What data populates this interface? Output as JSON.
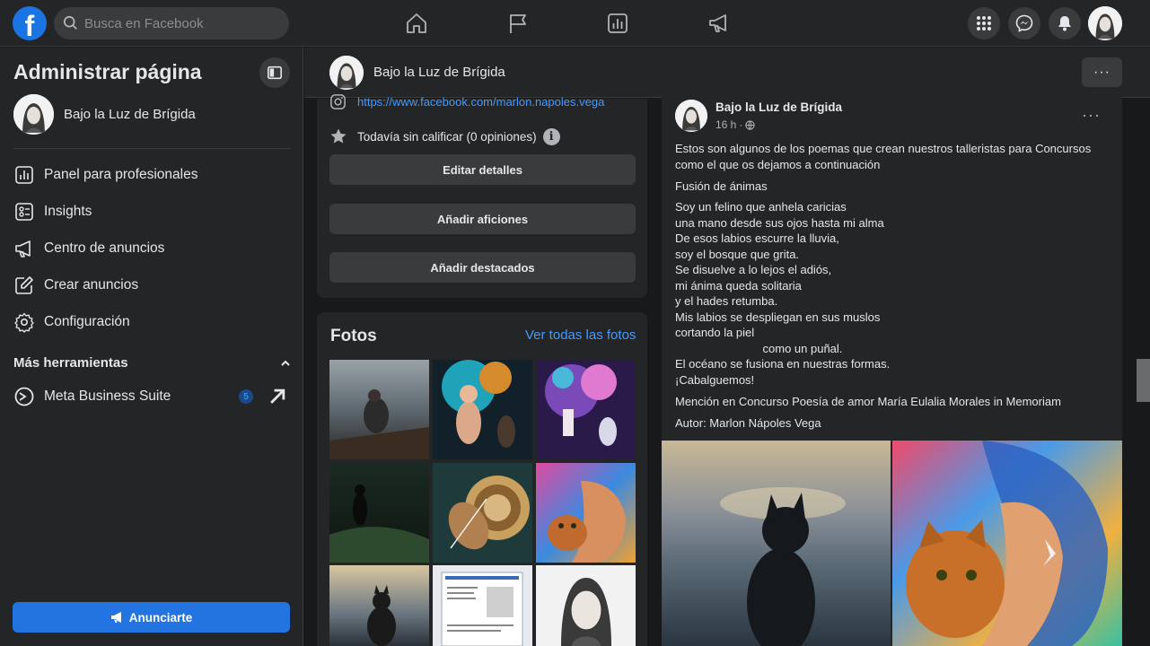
{
  "topbar": {
    "logo_letter": "f",
    "search_placeholder": "Busca en Facebook"
  },
  "sidebar": {
    "title": "Administrar página",
    "page_name": "Bajo la Luz de Brígida",
    "items": [
      {
        "label": "Panel para profesionales",
        "icon": "dashboard-icon"
      },
      {
        "label": "Insights",
        "icon": "insights-icon"
      },
      {
        "label": "Centro de anuncios",
        "icon": "megaphone-icon"
      },
      {
        "label": "Crear anuncios",
        "icon": "edit-icon"
      },
      {
        "label": "Configuración",
        "icon": "gear-icon"
      }
    ],
    "more_tools_label": "Más herramientas",
    "meta_suite": {
      "label": "Meta Business Suite",
      "badge": "5"
    },
    "promote_label": "Anunciarte"
  },
  "page_header": {
    "name": "Bajo la Luz de Brígida",
    "more_label": "···"
  },
  "about": {
    "link": "https://www.facebook.com/marlon.napoles.vega",
    "rating": "Todavía sin calificar (0 opiniones)",
    "info_glyph": "i",
    "buttons": [
      "Editar detalles",
      "Añadir aficiones",
      "Añadir destacados"
    ]
  },
  "photos": {
    "title": "Fotos",
    "see_all": "Ver todas las fotos"
  },
  "post": {
    "author": "Bajo la Luz de Brígida",
    "time": "16 h",
    "dots": "···",
    "intro": "Estos son algunos de los poemas que crean nuestros talleristas para Concursos\ncomo el que os dejamos a continuación",
    "poem_title": "Fusión de ánimas",
    "poem": "Soy un felino que anhela caricias\nuna mano desde sus ojos hasta mi alma\nDe esos labios escurre la lluvia,\nsoy el bosque que grita.\nSe disuelve a lo lejos el adiós,\nmi ánima queda solitaria\ny el hades retumba.\nMis labios se despliegan en sus muslos\ncortando la piel\n                           como un puñal.\nEl océano se fusiona en nuestras formas.\n¡Cabalguemos!",
    "mention": "Mención en Concurso Poesía de amor María Eulalia Morales in Memoriam",
    "author_line": "Autor: Marlon Nápoles Vega"
  },
  "colors": {
    "background": "#18191a",
    "surface": "#242526",
    "accent": "#2374e1",
    "link": "#4599ff"
  }
}
